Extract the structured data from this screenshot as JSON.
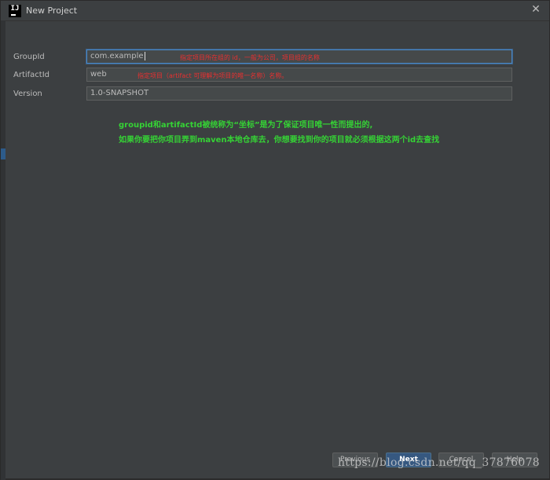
{
  "window": {
    "title": "New Project",
    "close_glyph": "✕"
  },
  "form": {
    "groupid_label": "GroupId",
    "groupid_value": "com.example",
    "artifactid_label": "ArtifactId",
    "artifactid_value": "web",
    "version_label": "Version",
    "version_value": "1.0-SNAPSHOT"
  },
  "annotations": {
    "groupid_note": "指定项目所在组的 id，一般为公司，项目组的名称",
    "artifactid_note": "指定项目（artifact 可理解为项目的唯一名称）名称。",
    "explain_line1": "groupid和artifactId被统称为“坐标”是为了保证项目唯一性而提出的,",
    "explain_line2": "如果你要把你项目弄到maven本地仓库去，你想要找到你的项目就必须根据这两个id去查找"
  },
  "buttons": {
    "previous": "Previous",
    "next": "Next",
    "cancel": "Cancel",
    "help": "Help"
  },
  "watermark": "https://blog.csdn.net/qq_37876078",
  "colors": {
    "dialog_bg": "#3c3f41",
    "field_bg": "#45494a",
    "focus_border": "#4a88c7",
    "annotation_red": "#e83030",
    "annotation_green": "#35d235",
    "default_button": "#365880"
  },
  "icons": {
    "app": "intellij-logo-icon",
    "close": "close-icon"
  }
}
